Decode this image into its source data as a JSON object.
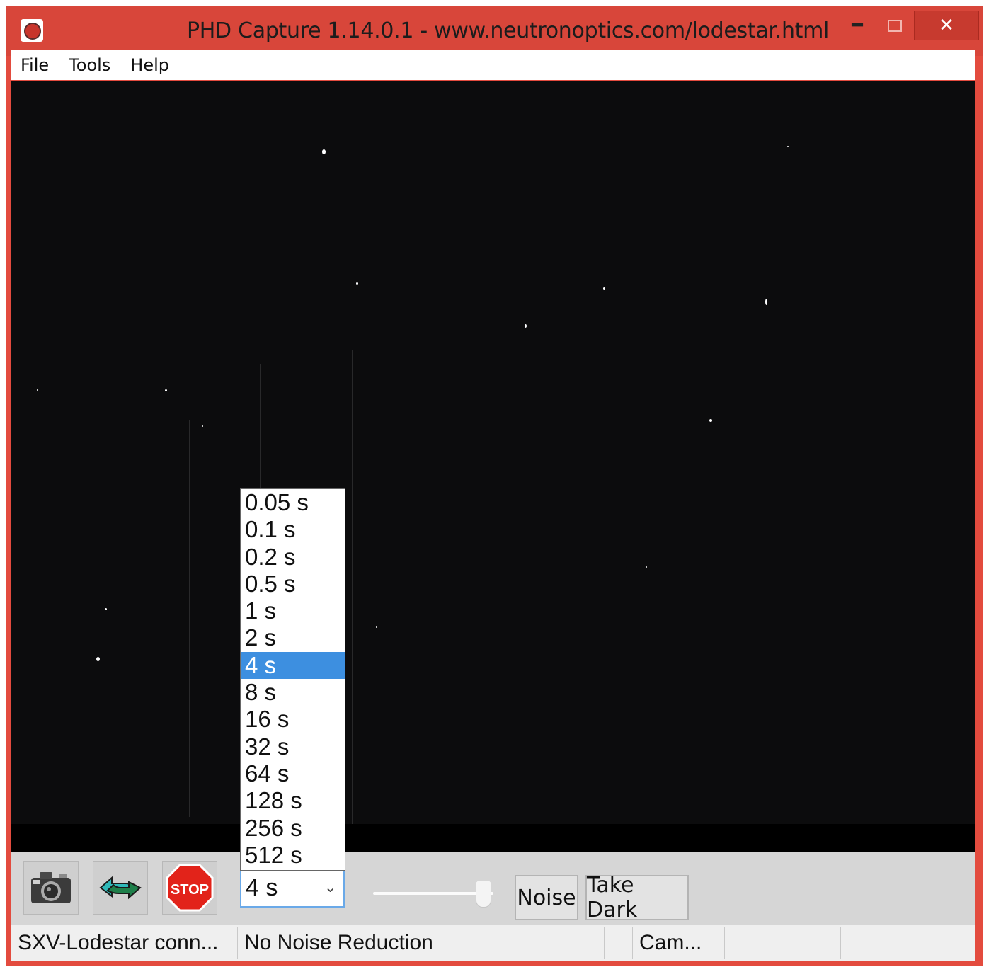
{
  "window": {
    "title": "PHD Capture 1.14.0.1  -  www.neutronoptics.com/lodestar.html",
    "controls": {
      "minimize": "━",
      "maximize": "",
      "close": "✕"
    }
  },
  "menu": [
    "File",
    "Tools",
    "Help"
  ],
  "toolbar": {
    "buttons": [
      {
        "icon": "camera-icon"
      },
      {
        "icon": "loop-icon"
      },
      {
        "icon": "stop-icon",
        "label": "STOP"
      }
    ],
    "exposure": {
      "value": "4 s",
      "chevron": "⌄"
    },
    "gamma_slider_level": 0.92,
    "noise_label": "Noise",
    "take_dark_label": "Take Dark"
  },
  "exposure_options": [
    "0.05 s",
    "0.1 s",
    "0.2 s",
    "0.5 s",
    "1 s",
    "2 s",
    "4 s",
    "8 s",
    "16 s",
    "32 s",
    "64 s",
    "128 s",
    "256 s",
    "512 s"
  ],
  "exposure_selected": "4 s",
  "status": {
    "camera": "SXV-Lodestar conn...",
    "noise": "No Noise Reduction",
    "cam_short": "Cam..."
  },
  "colors": {
    "titlebar": "#d8463a",
    "close_button": "#c73a2f",
    "selection": "#3d8fe0",
    "canvas": "#0c0c0d"
  }
}
